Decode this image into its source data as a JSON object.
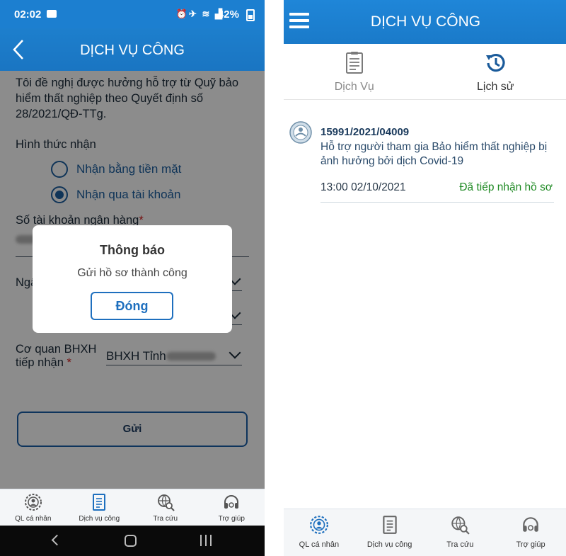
{
  "left_screen": {
    "status_bar": {
      "time": "02:02",
      "battery": "42%"
    },
    "header": {
      "title": "DỊCH VỤ CÔNG"
    },
    "form": {
      "intro_text": "Tôi đề nghị được hưởng hỗ trợ từ Quỹ bảo hiểm thất nghiệp theo Quyết định số 28/2021/QĐ-TTg.",
      "receive_method_label": "Hình thức nhận",
      "options": [
        {
          "label": "Nhận bằng tiền mặt",
          "selected": false
        },
        {
          "label": "Nhận qua tài khoản",
          "selected": true
        }
      ],
      "bank_account_label": "Số tài khoản ngân hàng",
      "bank_label_partial": "Ngâ",
      "required_mark": "*",
      "agency_label_line1": "Cơ quan BHXH",
      "agency_label_line2": "tiếp nhận",
      "agency_value": "BHXH Tỉnh",
      "submit_label": "Gửi"
    },
    "dialog": {
      "title": "Thông báo",
      "message": "Gửi hồ sơ thành công",
      "close_label": "Đóng"
    },
    "bottom_nav": [
      {
        "label": "QL cá nhân",
        "icon": "person-gear-icon"
      },
      {
        "label": "Dịch vụ công",
        "icon": "document-icon"
      },
      {
        "label": "Tra cứu",
        "icon": "globe-search-icon"
      },
      {
        "label": "Trợ giúp",
        "icon": "headset-icon"
      }
    ]
  },
  "right_screen": {
    "header": {
      "title": "DỊCH VỤ CÔNG"
    },
    "tabs": [
      {
        "label": "Dịch Vụ",
        "icon": "document-icon",
        "active": false
      },
      {
        "label": "Lịch sử",
        "icon": "history-icon",
        "active": true
      }
    ],
    "records": [
      {
        "code": "15991/2021/04009",
        "description": "Hỗ trợ người tham gia Bảo hiểm thất nghiệp bị ảnh hưởng bởi dịch Covid-19",
        "time": "13:00 02/10/2021",
        "status": "Đã tiếp nhận hồ sơ"
      }
    ],
    "bottom_nav": [
      {
        "label": "QL cá nhân",
        "icon": "person-gear-icon"
      },
      {
        "label": "Dịch vụ công",
        "icon": "document-icon"
      },
      {
        "label": "Tra cứu",
        "icon": "globe-search-icon"
      },
      {
        "label": "Trợ giúp",
        "icon": "headset-icon"
      }
    ]
  },
  "colors": {
    "primary": "#1c7fd0",
    "status_green": "#1f8a24",
    "required_red": "#d62020"
  }
}
